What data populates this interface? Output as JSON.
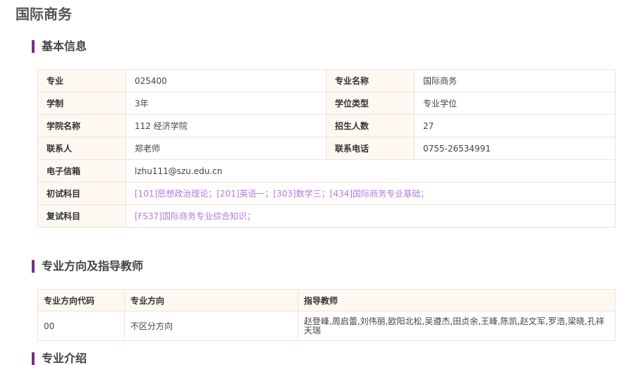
{
  "page": {
    "title": "国际商务"
  },
  "sections": {
    "basic_info": "基本信息",
    "directions": "专业方向及指导教师",
    "intro": "专业介绍"
  },
  "info": {
    "major_code_label": "专业",
    "major_code": "025400",
    "major_name_label": "专业名称",
    "major_name": "国际商务",
    "duration_label": "学制",
    "duration": "3年",
    "degree_type_label": "学位类型",
    "degree_type": "专业学位",
    "college_label": "学院名称",
    "college": "112 经济学院",
    "enrollment_label": "招生人数",
    "enrollment": "27",
    "contact_label": "联系人",
    "contact": "郑老师",
    "phone_label": "联系电话",
    "phone": "0755-26534991",
    "email_label": "电子信箱",
    "email": "lzhu111@szu.edu.cn",
    "prelim_label": "初试科目",
    "prelim": "[101]思想政治理论；[201]英语一；[303]数学三；[434]国际商务专业基础；",
    "retest_label": "复试科目",
    "retest": "[FS37]国际商务专业综合知识；"
  },
  "directions_table": {
    "headers": [
      "专业方向代码",
      "专业方向",
      "指导教师"
    ],
    "rows": [
      {
        "code": "00",
        "direction": "不区分方向",
        "advisors": "赵登峰,周启蕾,刘伟丽,欧阳北松,吴遵杰,田贞余,王峰,陈凯,赵文军,罗浩,梁晓,孔祥天瑞"
      }
    ]
  },
  "colors": {
    "accent": "#7b2c8e",
    "subject_link": "#b57ad8",
    "label_bg": "#fdf8f2",
    "border": "#efe3d6"
  }
}
